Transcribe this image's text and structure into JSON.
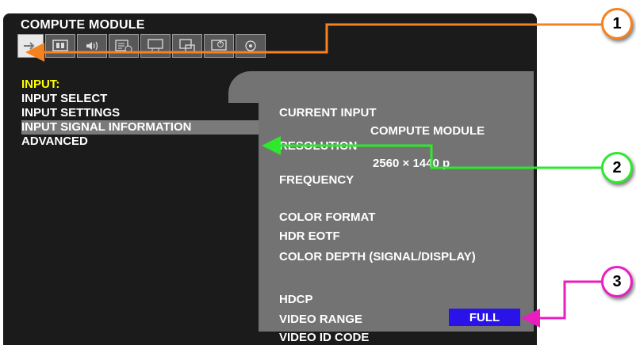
{
  "osd": {
    "title": "COMPUTE MODULE",
    "icons": [
      "input-icon",
      "picture-icon",
      "audio-icon",
      "schedule-icon",
      "screen-adjust-icon",
      "multi-screen-icon",
      "power-settings-icon",
      "system-icon"
    ]
  },
  "menu": {
    "heading": "INPUT:",
    "items": [
      "INPUT SELECT",
      "INPUT SETTINGS",
      "INPUT SIGNAL INFORMATION",
      "ADVANCED"
    ]
  },
  "info": {
    "current_input_label": "CURRENT INPUT",
    "current_input_value": "COMPUTE MODULE",
    "resolution_label": "RESOLUTION",
    "resolution_value": "2560 × 1440 p",
    "frequency_label": "FREQUENCY",
    "color_format_label": "COLOR FORMAT",
    "hdr_eotf_label": "HDR EOTF",
    "color_depth_label": "COLOR DEPTH (SIGNAL/DISPLAY)",
    "hdcp_label": "HDCP",
    "video_range_label": "VIDEO RANGE",
    "video_range_value": "FULL",
    "video_id_label": "VIDEO ID CODE"
  },
  "callouts": [
    {
      "number": "1",
      "color": "#f58220"
    },
    {
      "number": "2",
      "color": "#2ee82e"
    },
    {
      "number": "3",
      "color": "#e81ec0"
    }
  ],
  "colors": {
    "menu_heading": "#ffff00",
    "badge": "#2a13e8",
    "panel": "#1b1b1b",
    "subpanel": "#737373"
  }
}
